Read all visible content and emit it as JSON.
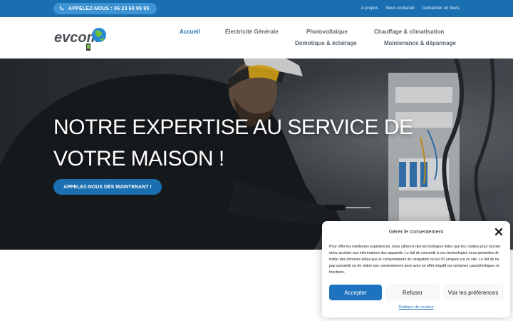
{
  "topbar": {
    "phone_label": "APPELEZ-NOUS : 06 23 60 95 95",
    "links": [
      "A propos",
      "Nous contacter",
      "Demander un devis"
    ]
  },
  "logo": {
    "text": "evcom"
  },
  "nav": {
    "items": [
      {
        "label": "Accueil",
        "active": true
      },
      {
        "label": "Électricité Générale",
        "active": false
      },
      {
        "label": "Photovoltaïque",
        "active": false
      },
      {
        "label": "Chauffage & climatisation",
        "active": false
      },
      {
        "label": "Domotique & éclairage",
        "active": false
      },
      {
        "label": "Maintenance & dépannage",
        "active": false
      }
    ]
  },
  "hero": {
    "title_line1": "NOTRE EXPERTISE AU SERVICE DE",
    "title_line2": "VOTRE MAISON !",
    "cta_label": "APPELEZ-NOUS DÈS MAINTENANT !"
  },
  "consent": {
    "title": "Gérer le consentement",
    "text": "Pour offrir les meilleures expériences, nous utilisons des technologies telles que les cookies pour stocker et/ou accéder aux informations des appareils. Le fait de consentir à ces technologies nous permettra de traiter des données telles que le comportement de navigation ou les ID uniques sur ce site. Le fait de ne pas consentir ou de retirer son consentement peut avoir un effet négatif sur certaines caractéristiques et fonctions.",
    "accept_label": "Accepter",
    "refuse_label": "Refuser",
    "prefs_label": "Voir les préférences",
    "policy_label": "Politique de cookies"
  },
  "colors": {
    "brand_blue": "#1a6fb0",
    "pill_blue": "#3d93d3",
    "nav_grey": "#5b6770",
    "accept_blue": "#1e73be"
  }
}
